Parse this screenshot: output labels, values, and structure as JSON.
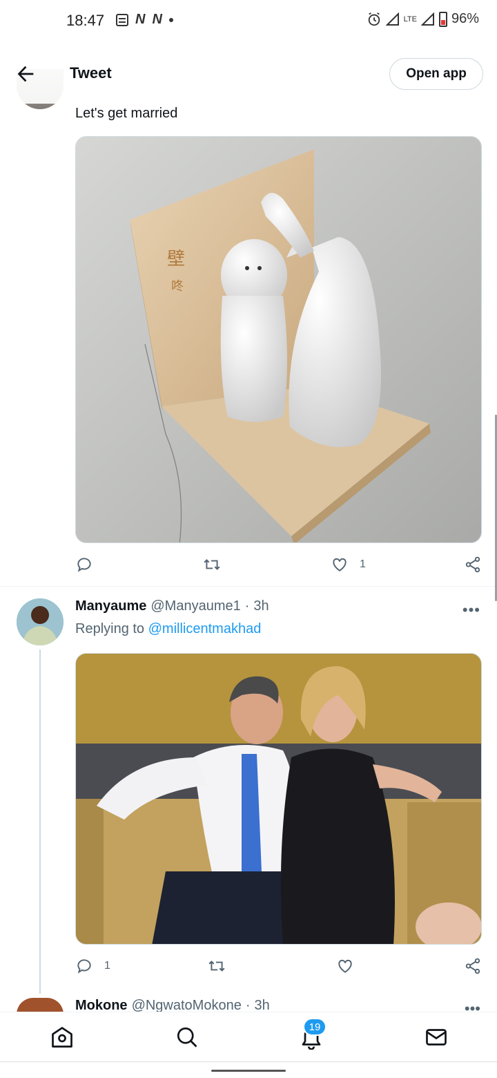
{
  "status_bar": {
    "time": "18:47",
    "left_icons": [
      "N",
      "N"
    ],
    "network": "LTE",
    "battery": "96%"
  },
  "header": {
    "title": "Tweet",
    "open_app_label": "Open app"
  },
  "tweet1": {
    "text": "Let's get married",
    "likes": "1",
    "image_alt_semantic": "ceramic-figurines-on-wooden-stand"
  },
  "tweet2": {
    "name": "Manyaume",
    "handle": "@Manyaume1",
    "sep": "·",
    "time": "3h",
    "replying_prefix": "Replying to",
    "replying_to": "@millicentmakhad",
    "replies": "1",
    "image_alt_semantic": "man-and-woman-talking-photo"
  },
  "tweet3": {
    "name": "Mokone",
    "handle": "@NgwatoMokone",
    "sep": "·",
    "time": "3h"
  },
  "bottom_nav": {
    "items": [
      "home-icon",
      "search-icon",
      "notifications-icon",
      "messages-icon"
    ],
    "notification_count": "19"
  },
  "colors": {
    "accent": "#1d9bf0",
    "secondary_text": "#536471",
    "primary_text": "#0f1419"
  }
}
